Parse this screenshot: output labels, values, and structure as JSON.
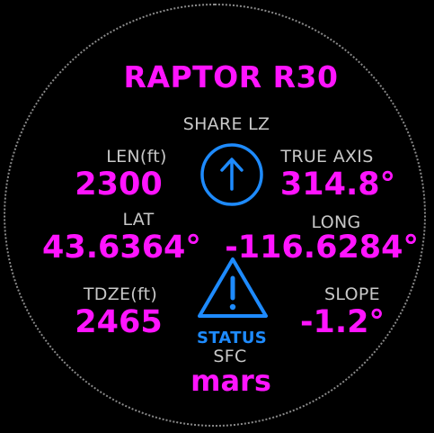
{
  "title": "RAPTOR R30",
  "share": {
    "label": "SHARE LZ",
    "icon": "arrow-up-circle-icon"
  },
  "length": {
    "label": "LEN(ft)",
    "value": "2300"
  },
  "true_axis": {
    "label": "TRUE AXIS",
    "value": "314.8°"
  },
  "lat": {
    "label": "LAT",
    "value": "43.6364°"
  },
  "long": {
    "label": "LONG",
    "value": "-116.6284°"
  },
  "tdze": {
    "label": "TDZE(ft)",
    "value": "2465"
  },
  "slope": {
    "label": "SLOPE",
    "value": "-1.2°"
  },
  "status": {
    "label": "STATUS",
    "icon": "warning-triangle-icon"
  },
  "sfc": {
    "label": "SFC",
    "value": "mars"
  },
  "colors": {
    "accent": "#ff14ff",
    "blue": "#1e8bff",
    "label": "#c8c8c8",
    "background": "#000000"
  }
}
